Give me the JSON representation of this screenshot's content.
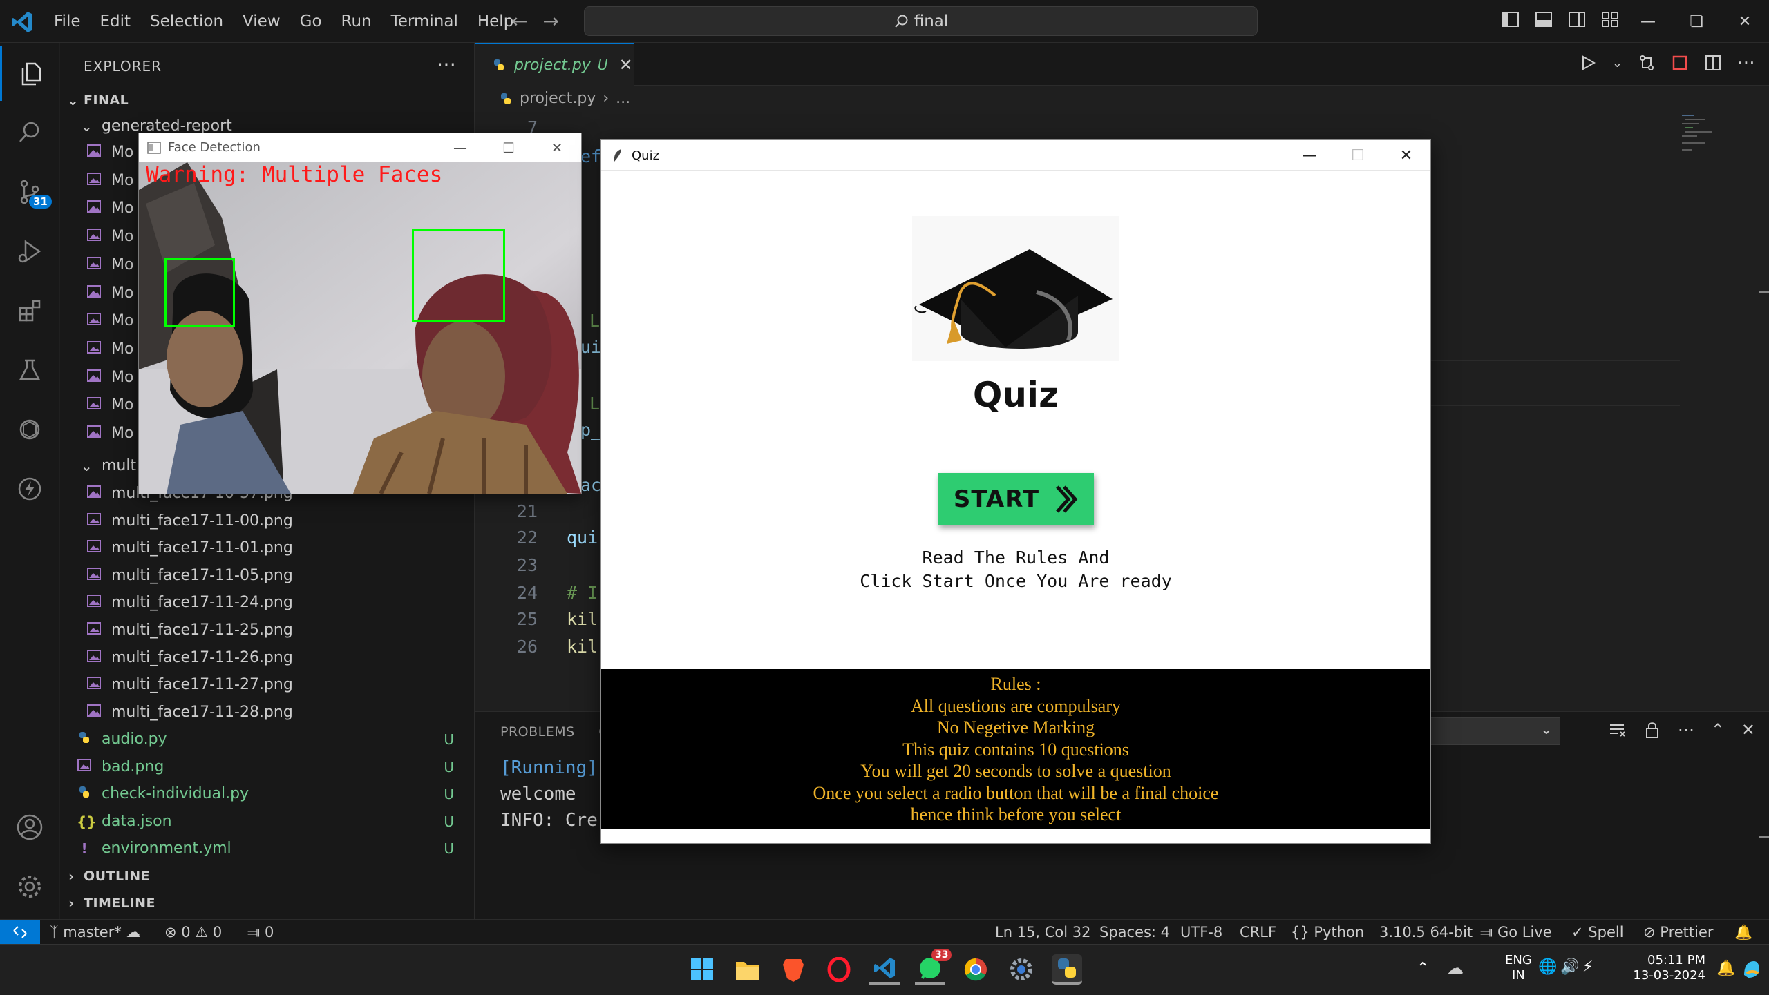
{
  "menu": [
    "File",
    "Edit",
    "Selection",
    "View",
    "Go",
    "Run",
    "Terminal",
    "Help"
  ],
  "command_center": {
    "text": "final"
  },
  "activity": {
    "scm_badge": "31"
  },
  "explorer": {
    "header": "EXPLORER",
    "root": "FINAL",
    "folder_generated": "generated-report",
    "truncated_items": [
      "Mo",
      "Mo",
      "Mo",
      "Mo",
      "Mo",
      "Mo",
      "Mo",
      "Mo",
      "Mo",
      "Mo",
      "Mo"
    ],
    "folder_multi": "multi",
    "multi_files": [
      "multi_face17-10-57.png",
      "multi_face17-11-00.png",
      "multi_face17-11-01.png",
      "multi_face17-11-05.png",
      "multi_face17-11-24.png",
      "multi_face17-11-25.png",
      "multi_face17-11-26.png",
      "multi_face17-11-27.png",
      "multi_face17-11-28.png"
    ],
    "root_files": [
      {
        "name": "audio.py",
        "icon": "python-icon",
        "status": "U"
      },
      {
        "name": "bad.png",
        "icon": "image-icon",
        "status": "U"
      },
      {
        "name": "check-individual.py",
        "icon": "python-icon",
        "status": "U"
      },
      {
        "name": "data.json",
        "icon": "json-icon",
        "status": "U"
      },
      {
        "name": "environment.yml",
        "icon": "yaml-icon",
        "status": "U"
      }
    ],
    "outline": "OUTLINE",
    "timeline": "TIMELINE"
  },
  "editor": {
    "tab_label": "project.py",
    "tab_status": "U",
    "breadcrumb_file": "project.py",
    "breadcrumb_more": "...",
    "line_numbers": [
      "7",
      "21",
      "22",
      "23",
      "24",
      "25",
      "26"
    ],
    "code_fragments": [
      "ef",
      "L",
      "ui",
      "L",
      "p_",
      "ac",
      "qui",
      "# I",
      "kil",
      "kil"
    ]
  },
  "panel": {
    "tab_problems": "PROBLEMS",
    "tab_truncated": "C",
    "terminal_lines": [
      "[Running]",
      "welcome",
      "INFO: Cre"
    ]
  },
  "statusbar": {
    "branch": "master*",
    "errors": "0",
    "warnings": "0",
    "ports": "0",
    "position": "Ln 15, Col 32",
    "spaces": "Spaces: 4",
    "encoding": "UTF-8",
    "eol": "CRLF",
    "language": "Python",
    "interpreter": "3.10.5 64-bit",
    "go_live": "Go Live",
    "spell": "Spell",
    "prettier": "Prettier"
  },
  "face_window": {
    "title": "Face Detection",
    "warning": "Warning: Multiple Faces"
  },
  "quiz_window": {
    "title": "Quiz",
    "heading": "Quiz",
    "start_label": "START",
    "instruction_1": "Read The Rules And",
    "instruction_2": "Click Start Once You Are ready",
    "rules": [
      "Rules :",
      "All questions are compulsary",
      "No Negetive Marking",
      "This quiz contains 10 questions",
      "You will get 20 seconds to solve a question",
      "Once you select a radio button that will be a final choice",
      "hence think before you select"
    ]
  },
  "taskbar": {
    "whatsapp_badge": "33",
    "lang_1": "ENG",
    "lang_2": "IN",
    "time": "05:11 PM",
    "date": "13-03-2024"
  },
  "colors": {
    "accent": "#0078d4",
    "git_untracked": "#73c991",
    "start_button": "#2ecc71",
    "rules_text": "#f0b429",
    "face_box": "#00ff00",
    "warning_text": "#ff1a1a"
  }
}
